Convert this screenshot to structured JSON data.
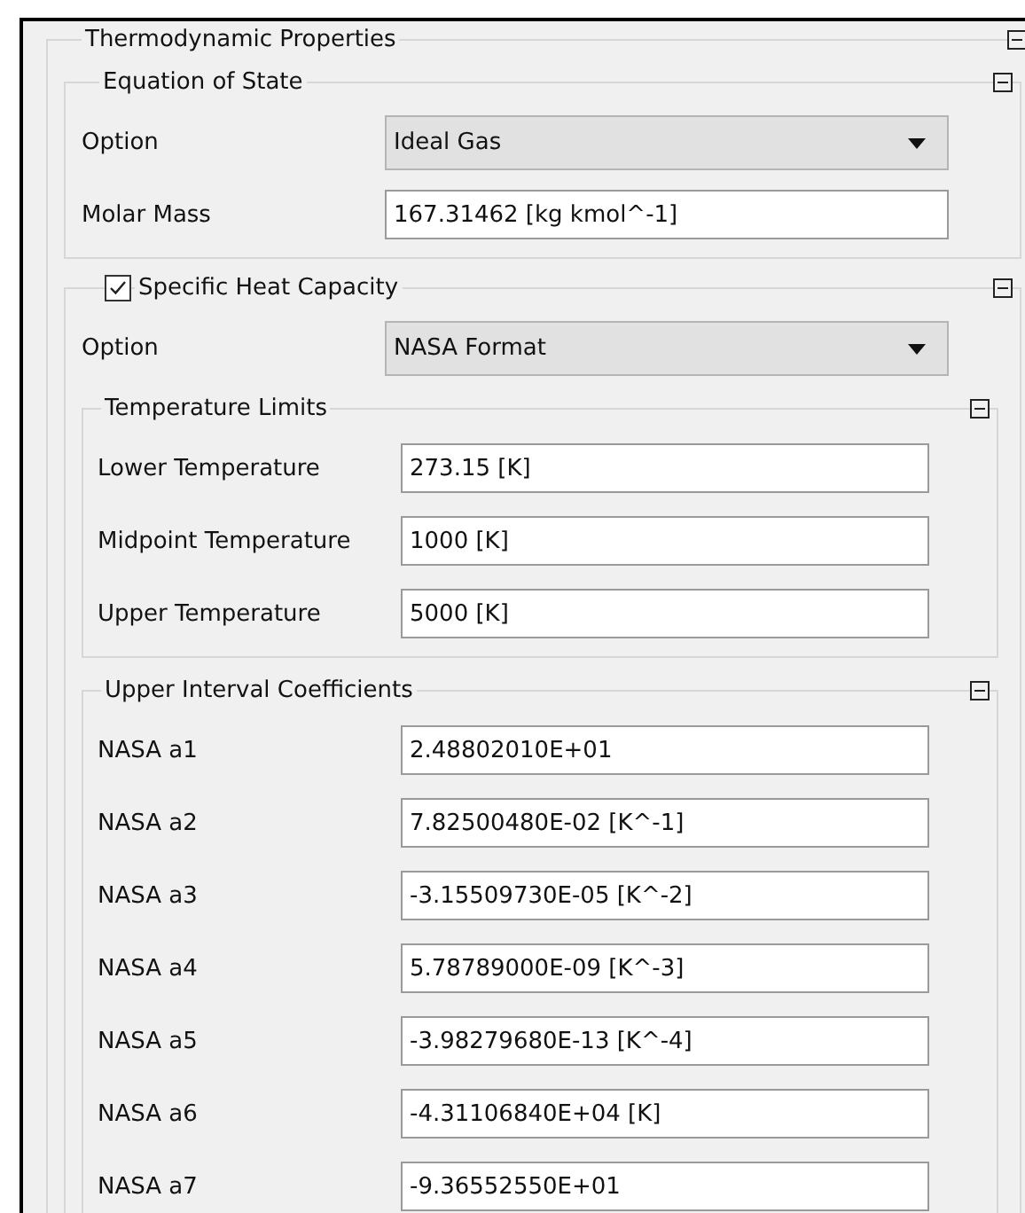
{
  "panel": {
    "title": "Thermodynamic Properties",
    "expanded": true,
    "sections": [
      {
        "title": "Equation of State",
        "expanded": true,
        "fields": [
          {
            "label": "Option",
            "kind": "dropdown",
            "value": "Ideal Gas"
          },
          {
            "label": "Molar Mass",
            "kind": "text",
            "value": "167.31462 [kg kmol^-1]"
          }
        ]
      },
      {
        "title": "Specific Heat Capacity",
        "checked": true,
        "expanded": true,
        "fields": [
          {
            "label": "Option",
            "kind": "dropdown",
            "value": "NASA Format"
          }
        ],
        "subsections": [
          {
            "title": "Temperature Limits",
            "expanded": true,
            "fields": [
              {
                "label": "Lower Temperature",
                "kind": "text",
                "value": "273.15 [K]"
              },
              {
                "label": "Midpoint Temperature",
                "kind": "text",
                "value": "1000 [K]"
              },
              {
                "label": "Upper Temperature",
                "kind": "text",
                "value": "5000 [K]"
              }
            ]
          },
          {
            "title": "Upper Interval Coefficients",
            "expanded": true,
            "fields": [
              {
                "label": "NASA a1",
                "kind": "text",
                "value": "2.48802010E+01"
              },
              {
                "label": "NASA a2",
                "kind": "text",
                "value": "7.82500480E-02 [K^-1]"
              },
              {
                "label": "NASA a3",
                "kind": "text",
                "value": "-3.15509730E-05 [K^-2]"
              },
              {
                "label": "NASA a4",
                "kind": "text",
                "value": "5.78789000E-09 [K^-3]"
              },
              {
                "label": "NASA a5",
                "kind": "text",
                "value": "-3.98279680E-13 [K^-4]"
              },
              {
                "label": "NASA a6",
                "kind": "text",
                "value": "-4.31106840E+04 [K]"
              },
              {
                "label": "NASA a7",
                "kind": "text",
                "value": "-9.36552550E+01"
              }
            ]
          }
        ]
      }
    ]
  }
}
